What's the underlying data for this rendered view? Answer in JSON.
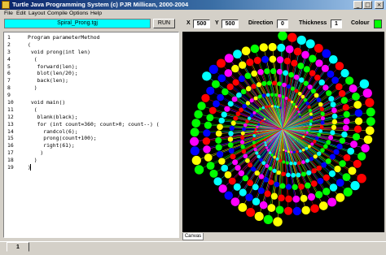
{
  "window": {
    "title": "Turtle Java Programming System  (c) PJR Millican, 2000-2004",
    "controls": {
      "minimize": "_",
      "maximize": "□",
      "close": "×"
    }
  },
  "menu": [
    "File",
    "Edit",
    "Layout",
    "Compile",
    "Options",
    "Help"
  ],
  "toolbar": {
    "file_name": "Spiral_Prong.tgj",
    "run_label": "RUN",
    "x_label": "X",
    "x_value": "500",
    "y_label": "Y",
    "y_value": "500",
    "direction_label": "Direction",
    "direction_value": "0",
    "thickness_label": "Thickness",
    "thickness_value": "1",
    "colour_label": "Colour",
    "colour_value": "#00ff00"
  },
  "editor": {
    "lines": [
      {
        "n": "1",
        "code": "Program parameterMethod"
      },
      {
        "n": "2",
        "code": "("
      },
      {
        "n": "3",
        "code": " void prong(int len)"
      },
      {
        "n": "4",
        "code": "  ("
      },
      {
        "n": "5",
        "code": "   forward(len);"
      },
      {
        "n": "6",
        "code": "   blot(len/20);"
      },
      {
        "n": "7",
        "code": "   back(len);"
      },
      {
        "n": "8",
        "code": "  )"
      },
      {
        "n": "9",
        "code": ""
      },
      {
        "n": "10",
        "code": " void main()"
      },
      {
        "n": "11",
        "code": "  ("
      },
      {
        "n": "12",
        "code": "   blank(black);"
      },
      {
        "n": "13",
        "code": "   for (int count=360; count>0; count--) ("
      },
      {
        "n": "14",
        "code": "     randcol(6);"
      },
      {
        "n": "15",
        "code": "     prong(count+100);"
      },
      {
        "n": "16",
        "code": "     right(61);"
      },
      {
        "n": "17",
        "code": "    )"
      },
      {
        "n": "18",
        "code": "  )"
      },
      {
        "n": "19",
        "code": ")"
      }
    ]
  },
  "canvas": {
    "tab_label": "Canvas",
    "background": "#000000",
    "palette": [
      "#ff0000",
      "#ffff00",
      "#00ff00",
      "#00ffff",
      "#0000ff",
      "#ff00ff"
    ]
  },
  "pages": {
    "active_tab": "1"
  }
}
